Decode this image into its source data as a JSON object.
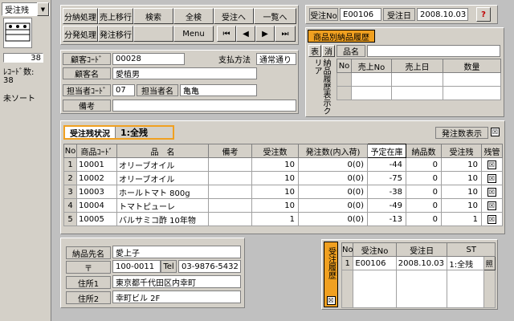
{
  "left": {
    "combo_value": "受注残",
    "count_value": "38",
    "record_label": "ﾚｺｰﾄﾞ数:",
    "record_value": "38",
    "sort_label": "未ソート"
  },
  "toolbar": {
    "row1": [
      "分納処理",
      "売上移行",
      "検索",
      "全検",
      "受注へ",
      "一覧へ"
    ],
    "row2": [
      "分発処理",
      "発注移行",
      "",
      "Menu"
    ],
    "nav": [
      "⏮",
      "◀",
      "▶",
      "⏭"
    ]
  },
  "header": {
    "order_no_label": "受注No",
    "order_no": "E00106",
    "order_date_label": "受注日",
    "order_date": "2008.10.03",
    "help": "?"
  },
  "customer": {
    "code_label": "顧客ｺｰﾄﾞ",
    "code": "00028",
    "pay_label": "支払方法",
    "pay_value": "通常通り",
    "name_label": "顧客名",
    "name": "愛植男",
    "staff_code_label": "担当者ｺｰﾄﾞ",
    "staff_code": "07",
    "staff_name_label": "担当者名",
    "staff_name": "亀亀",
    "note_label": "備考",
    "note": ""
  },
  "history_product": {
    "title": "商品別納品履歴",
    "search_btn": "表",
    "clear_btn": "消",
    "name_label": "品名",
    "vertical_label": "納品履歴表示クリア",
    "columns": [
      "No",
      "売上No",
      "売上日",
      "数量"
    ]
  },
  "status": {
    "title": "受注残状況",
    "value": "1:全残",
    "order_show_label": "発注数表示",
    "order_show_checked": "☒"
  },
  "items": {
    "columns": [
      "No",
      "商品ｺｰﾄﾞ",
      "品　名",
      "備考",
      "受注数",
      "発注数(内入荷)",
      "予定在庫",
      "納品数",
      "受注残",
      "残管"
    ],
    "rows": [
      {
        "no": "1",
        "code": "10001",
        "name": "オリーブオイル",
        "note": "",
        "qty": "10",
        "ordered": "0(0)",
        "stock": "-44",
        "delivered": "0",
        "remain": "10",
        "chk": "☒"
      },
      {
        "no": "2",
        "code": "10002",
        "name": "オリーブオイル",
        "note": "",
        "qty": "10",
        "ordered": "0(0)",
        "stock": "-75",
        "delivered": "0",
        "remain": "10",
        "chk": "☒"
      },
      {
        "no": "3",
        "code": "10003",
        "name": "ホールトマト 800g",
        "note": "",
        "qty": "10",
        "ordered": "0(0)",
        "stock": "-38",
        "delivered": "0",
        "remain": "10",
        "chk": "☒"
      },
      {
        "no": "4",
        "code": "10004",
        "name": "トマトピューレ",
        "note": "",
        "qty": "10",
        "ordered": "0(0)",
        "stock": "-49",
        "delivered": "0",
        "remain": "10",
        "chk": "☒"
      },
      {
        "no": "5",
        "code": "10005",
        "name": "バルサミコ酢 10年物",
        "note": "",
        "qty": "1",
        "ordered": "0(0)",
        "stock": "-13",
        "delivered": "0",
        "remain": "1",
        "chk": "☒"
      }
    ]
  },
  "delivery": {
    "name_label": "納品先名",
    "name": "愛上子",
    "zip_label": "〒",
    "zip": "100-0011",
    "tel_label": "Tel",
    "tel": "03-9876-5432",
    "addr1_label": "住所1",
    "addr1": "東京都千代田区内幸町",
    "addr2_label": "住所2",
    "addr2": "幸町ビル 2F"
  },
  "order_history": {
    "vertical_label": "受注履歴",
    "check": "☒",
    "columns": [
      "No",
      "受注No",
      "受注日",
      "ST"
    ],
    "rows": [
      {
        "no": "1",
        "order_no": "E00106",
        "date": "2008.10.03",
        "st": "1:全残",
        "btn": "照"
      }
    ]
  }
}
